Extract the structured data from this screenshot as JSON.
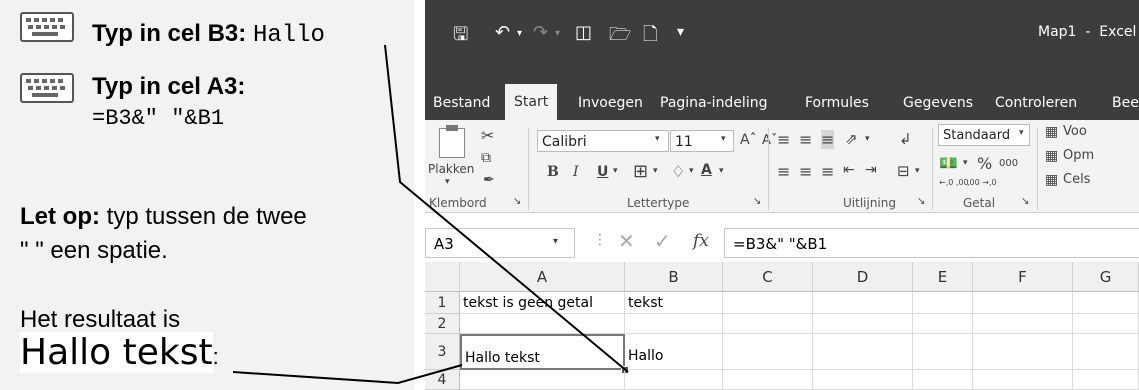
{
  "instructions": {
    "step1_label": "Typ in cel B3:",
    "step1_value": "Hallo",
    "step2_label": "Typ in cel A3:",
    "step2_value": "=B3&\" \"&B1",
    "note_bold": "Let op:",
    "note_line1": " typ tussen de twee",
    "note_line2": "\" \" een spatie.",
    "result_label": "Het resultaat is",
    "result_value": "Hallo tekst",
    "result_trailing": ":"
  },
  "excel": {
    "title": "Map1  -  Excel",
    "tabs": [
      "Bestand",
      "Start",
      "Invoegen",
      "Pagina-indeling",
      "Formules",
      "Gegevens",
      "Controleren",
      "Bee"
    ],
    "active_tab": "Start",
    "ribbon": {
      "paste_label": "Plakken",
      "font_name": "Calibri",
      "font_size": "11",
      "number_format": "Standaard",
      "percent": "%",
      "thousands": "000",
      "dec_inc": "←,0 ,00",
      "dec_dec": ",00 →,0",
      "styles_items": [
        "Voo",
        "Opm",
        "Cels"
      ],
      "groups": [
        "Klembord",
        "Lettertype",
        "Uitlijning",
        "Getal"
      ]
    },
    "name_box": "A3",
    "formula": "=B3&\" \"&B1",
    "fx_label": "fx",
    "columns": [
      "A",
      "B",
      "C",
      "D",
      "E",
      "F",
      "G"
    ],
    "rows": [
      "1",
      "2",
      "3",
      "4"
    ],
    "cells": {
      "A1": "tekst is geen getal",
      "B1": "tekst",
      "A3": "Hallo tekst",
      "B3": "Hallo"
    },
    "selected_cell": "A3"
  }
}
